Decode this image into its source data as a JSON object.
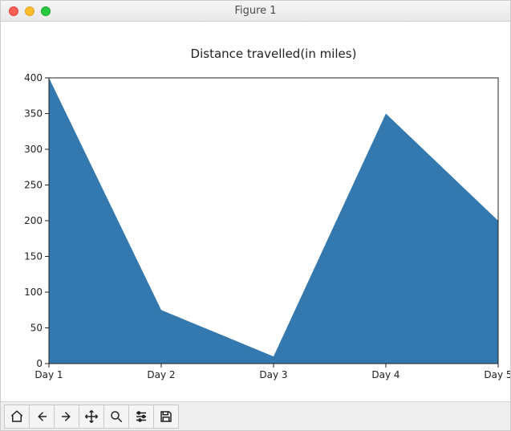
{
  "window": {
    "title": "Figure 1"
  },
  "toolbar": {
    "home": "home-icon",
    "back": "back-icon",
    "forward": "forward-icon",
    "pan": "pan-icon",
    "zoom": "zoom-icon",
    "configure": "configure-icon",
    "save": "save-icon"
  },
  "chart_data": {
    "type": "area",
    "title": "Distance travelled(in miles)",
    "xlabel": "",
    "ylabel": "",
    "categories": [
      "Day 1",
      "Day 2",
      "Day 3",
      "Day 4",
      "Day 5"
    ],
    "values": [
      400,
      75,
      10,
      350,
      200
    ],
    "ylim": [
      0,
      400
    ],
    "yticks": [
      0,
      50,
      100,
      150,
      200,
      250,
      300,
      350,
      400
    ],
    "fill_color": "#3379af"
  }
}
